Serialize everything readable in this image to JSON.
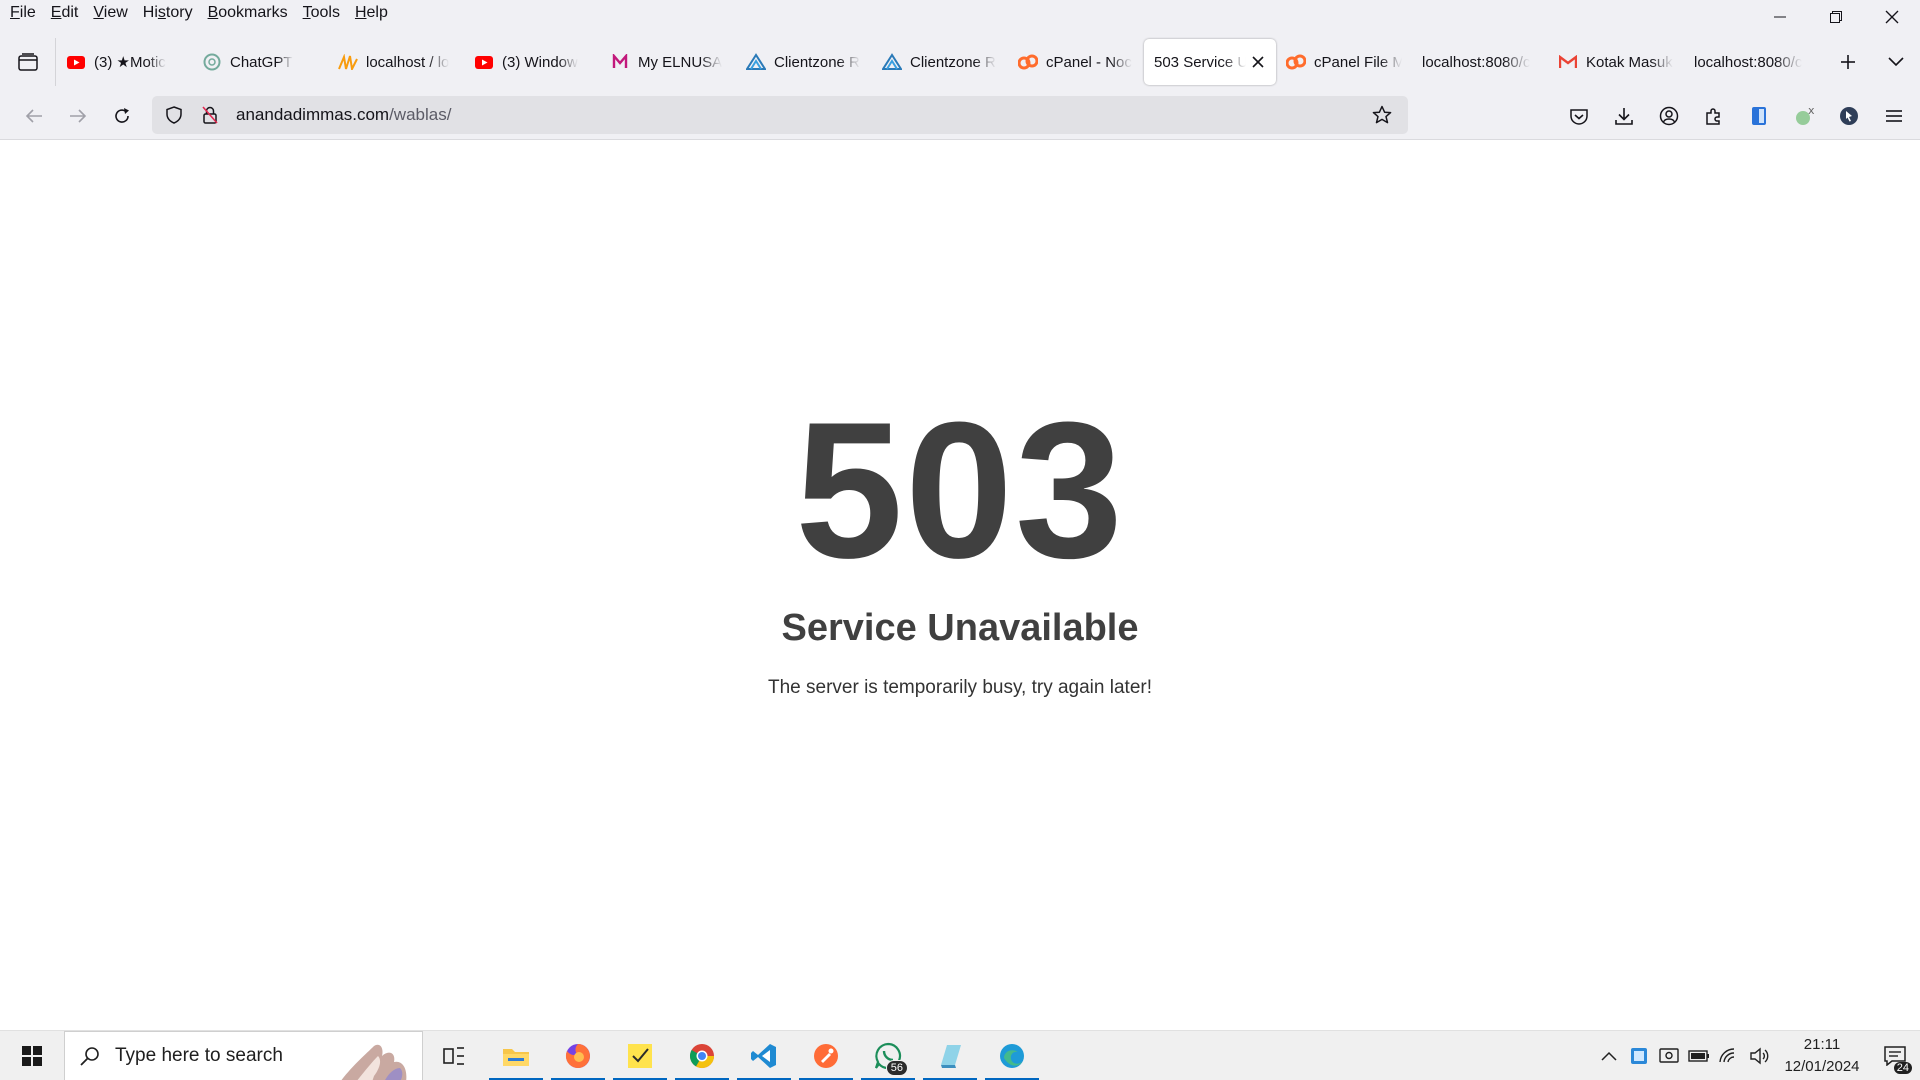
{
  "menubar": {
    "items": [
      {
        "key": "F",
        "rest": "ile"
      },
      {
        "key": "E",
        "rest": "dit"
      },
      {
        "key": "V",
        "rest": "iew"
      },
      {
        "key": "",
        "pre": "Hi",
        "u": "s",
        "rest": "tory"
      },
      {
        "key": "B",
        "rest": "ookmarks"
      },
      {
        "key": "T",
        "rest": "ools"
      },
      {
        "key": "H",
        "rest": "elp"
      }
    ]
  },
  "tabs": [
    {
      "title": "(3) ★Motic",
      "icon": "youtube-icon"
    },
    {
      "title": "ChatGPT",
      "icon": "chatgpt-icon"
    },
    {
      "title": "localhost / lo",
      "icon": "phpmyadmin-icon"
    },
    {
      "title": "(3) Window",
      "icon": "youtube-icon"
    },
    {
      "title": "My ELNUSA",
      "icon": "elnusa-icon"
    },
    {
      "title": "Clientzone R",
      "icon": "clientzone-icon"
    },
    {
      "title": "Clientzone R",
      "icon": "clientzone-icon"
    },
    {
      "title": "cPanel - Noc",
      "icon": "cpanel-icon"
    },
    {
      "title": "503 Service U",
      "icon": "",
      "active": true
    },
    {
      "title": "cPanel File M",
      "icon": "cpanel-icon"
    },
    {
      "title": "localhost:8080/c",
      "icon": ""
    },
    {
      "title": "Kotak Masuk",
      "icon": "gmail-icon"
    },
    {
      "title": "localhost:8080/c",
      "icon": ""
    }
  ],
  "url": {
    "domain": "anandadimmas.com",
    "path": "/wablas/"
  },
  "page": {
    "code": "503",
    "title": "Service Unavailable",
    "message": "The server is temporarily busy, try again later!"
  },
  "taskbar": {
    "search_placeholder": "Type here to search",
    "whatsapp_badge": "56",
    "time": "21:11",
    "date": "12/01/2024",
    "notification_count": "24"
  },
  "colors": {
    "chrome_bg": "#f0f0f4",
    "urlbar_bg": "#e1e1e5",
    "error_text": "#404040",
    "taskbar_bg": "#f0f0f0",
    "accent": "#0067c0"
  }
}
